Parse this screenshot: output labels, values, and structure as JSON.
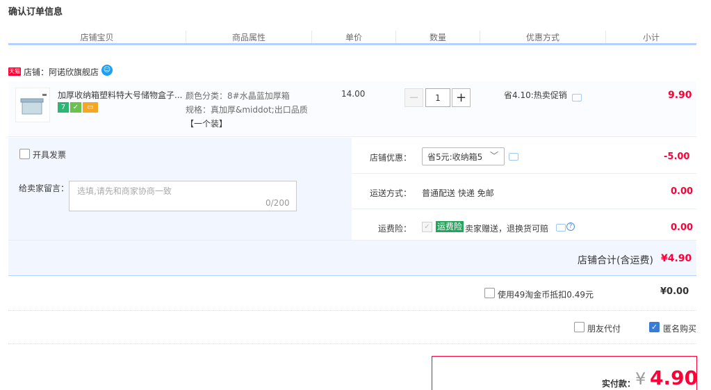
{
  "page_title": "确认订单信息",
  "columns": [
    "店铺宝贝",
    "商品属性",
    "单价",
    "数量",
    "优惠方式",
    "小计"
  ],
  "shop": {
    "badge": "天猫",
    "label": "店铺：阿诺欣旗舰店"
  },
  "item": {
    "title": "加厚收纳箱塑料特大号储物盒子...",
    "attr_color": "颜色分类：8#水晶蓝加厚箱",
    "attr_spec": "规格：真加厚&middot;出口品质",
    "attr_spec2": "【一个装】",
    "price": "14.00",
    "quantity": "1",
    "promotion": "省4.10:热卖促销",
    "subtotal": "9.90"
  },
  "invoice": {
    "label": "开具发票"
  },
  "message": {
    "label": "给卖家留言：",
    "placeholder": "选填,请先和商家协商一致",
    "counter": "0/200"
  },
  "shop_discount": {
    "label": "店铺优惠：",
    "selected": "省5元:收纳箱5",
    "value": "-5.00"
  },
  "shipping": {
    "label": "运送方式：",
    "method": "普通配送 快递 免邮",
    "value": "0.00"
  },
  "insurance": {
    "label": "运费险：",
    "tag": "运费险",
    "text": "卖家赠送，退换货可赔",
    "value": "0.00"
  },
  "shop_total": {
    "label": "店铺合计(含运费)",
    "value": "¥4.90"
  },
  "coins": {
    "label": "使用49淘金币抵扣0.49元",
    "value": "¥0.00"
  },
  "options": {
    "friend_pay": "朋友代付",
    "anonymous": "匿名购买"
  },
  "payment": {
    "label": "实付款：",
    "currency": "¥",
    "value": "4.90"
  },
  "colors": {
    "accent_red": "#ff0036",
    "blue_line": "#b2d1ff",
    "panel_bg": "#f2f7ff",
    "insurance_green": "#24a55b"
  },
  "icons": [
    "tmall-badge",
    "wangwang-icon",
    "chat-icon",
    "question-icon",
    "checkbox-checked"
  ]
}
